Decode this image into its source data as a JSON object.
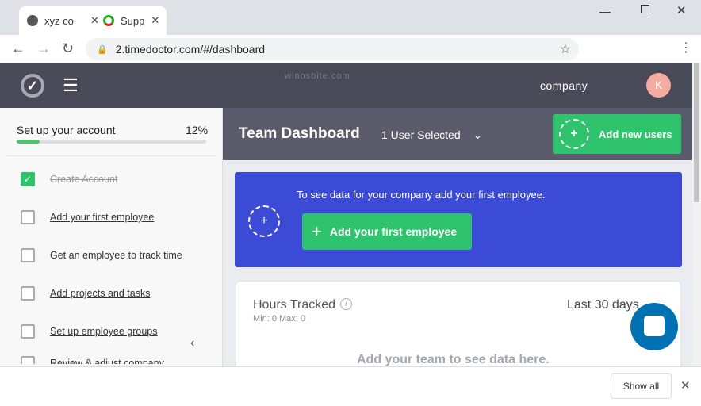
{
  "browser": {
    "tabs": [
      {
        "title": "xyz co"
      },
      {
        "title": "Supp"
      }
    ],
    "url": "2.timedoctor.com/#/dashboard",
    "window_controls": [
      "minimize",
      "maximize",
      "close"
    ]
  },
  "app": {
    "watermark": "winosbite.com",
    "company": "company",
    "avatar_initial": "K"
  },
  "sidebar": {
    "title": "Set up your account",
    "progress_label": "12%",
    "progress": 12,
    "items": [
      {
        "label": "Create Account",
        "done": true
      },
      {
        "label": "Add your first employee",
        "done": false
      },
      {
        "label": "Get an employee to track time",
        "done": false
      },
      {
        "label": "Add projects and tasks",
        "done": false
      },
      {
        "label": "Set up employee groups",
        "done": false
      },
      {
        "label": "Review & adjust company",
        "done": false
      }
    ]
  },
  "main": {
    "title": "Team Dashboard",
    "user_select": "1 User Selected",
    "add_users": "Add new users",
    "banner": {
      "text": "To see data for your company add your first employee.",
      "button": "Add your first employee"
    },
    "card": {
      "title": "Hours Tracked",
      "subtitle": "Min: 0 Max: 0",
      "range": "Last 30 days",
      "empty": "Add your team to see data here."
    }
  },
  "download_bar": {
    "show_all": "Show all"
  },
  "colors": {
    "green": "#2ec36c",
    "blue": "#3c4bd6",
    "header": "#484a57",
    "chat": "#0071b2"
  }
}
